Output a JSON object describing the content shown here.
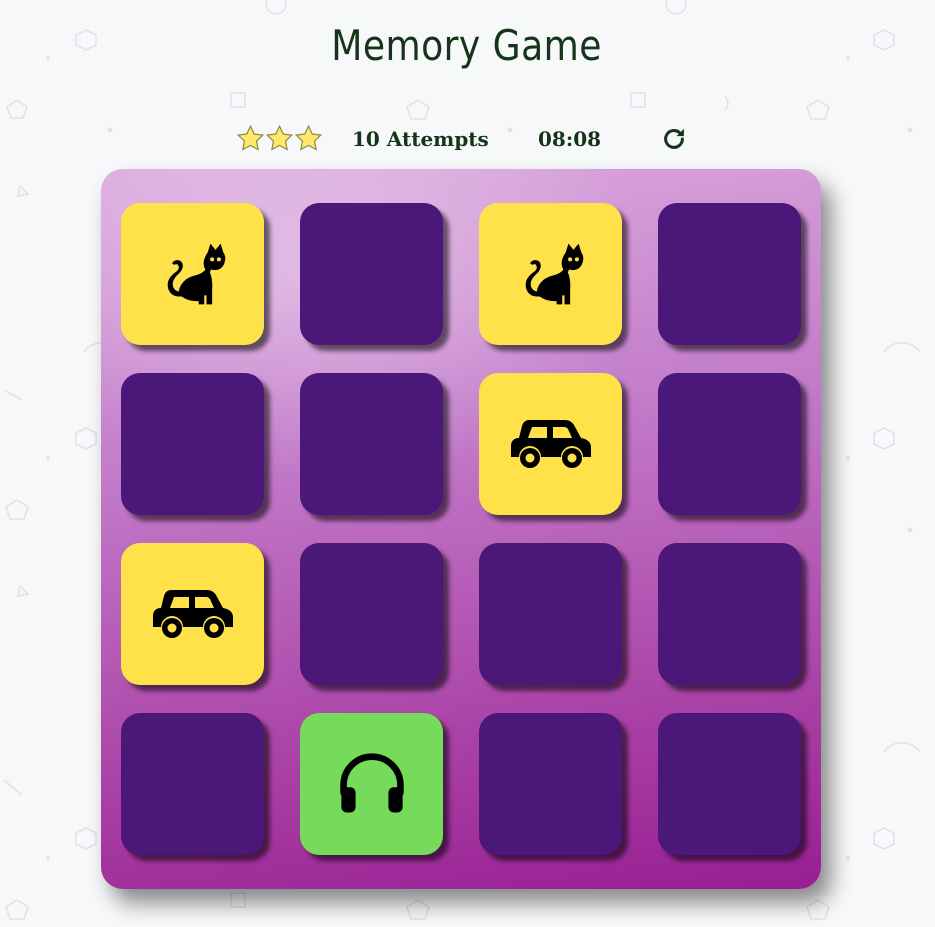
{
  "game": {
    "title": "Memory Game",
    "rating_stars": 3,
    "attempts_text": "10 Attempts",
    "timer": "08:08",
    "restart_icon": "redo-icon"
  },
  "deck": {
    "columns": 4,
    "rows": 4,
    "cards": [
      {
        "state": "open",
        "icon": "cat-icon"
      },
      {
        "state": "closed",
        "icon": ""
      },
      {
        "state": "open",
        "icon": "cat-icon"
      },
      {
        "state": "closed",
        "icon": ""
      },
      {
        "state": "closed",
        "icon": ""
      },
      {
        "state": "closed",
        "icon": ""
      },
      {
        "state": "open",
        "icon": "car-icon"
      },
      {
        "state": "closed",
        "icon": ""
      },
      {
        "state": "open",
        "icon": "car-icon"
      },
      {
        "state": "closed",
        "icon": ""
      },
      {
        "state": "closed",
        "icon": ""
      },
      {
        "state": "closed",
        "icon": ""
      },
      {
        "state": "closed",
        "icon": ""
      },
      {
        "state": "match",
        "icon": "headphones-icon"
      },
      {
        "state": "closed",
        "icon": ""
      },
      {
        "state": "closed",
        "icon": ""
      }
    ]
  },
  "colors": {
    "card_closed": "#4b1778",
    "card_open": "#ffe24a",
    "card_match": "#76da5a",
    "star_fill": "#ffe86a",
    "text": "#16341a"
  }
}
